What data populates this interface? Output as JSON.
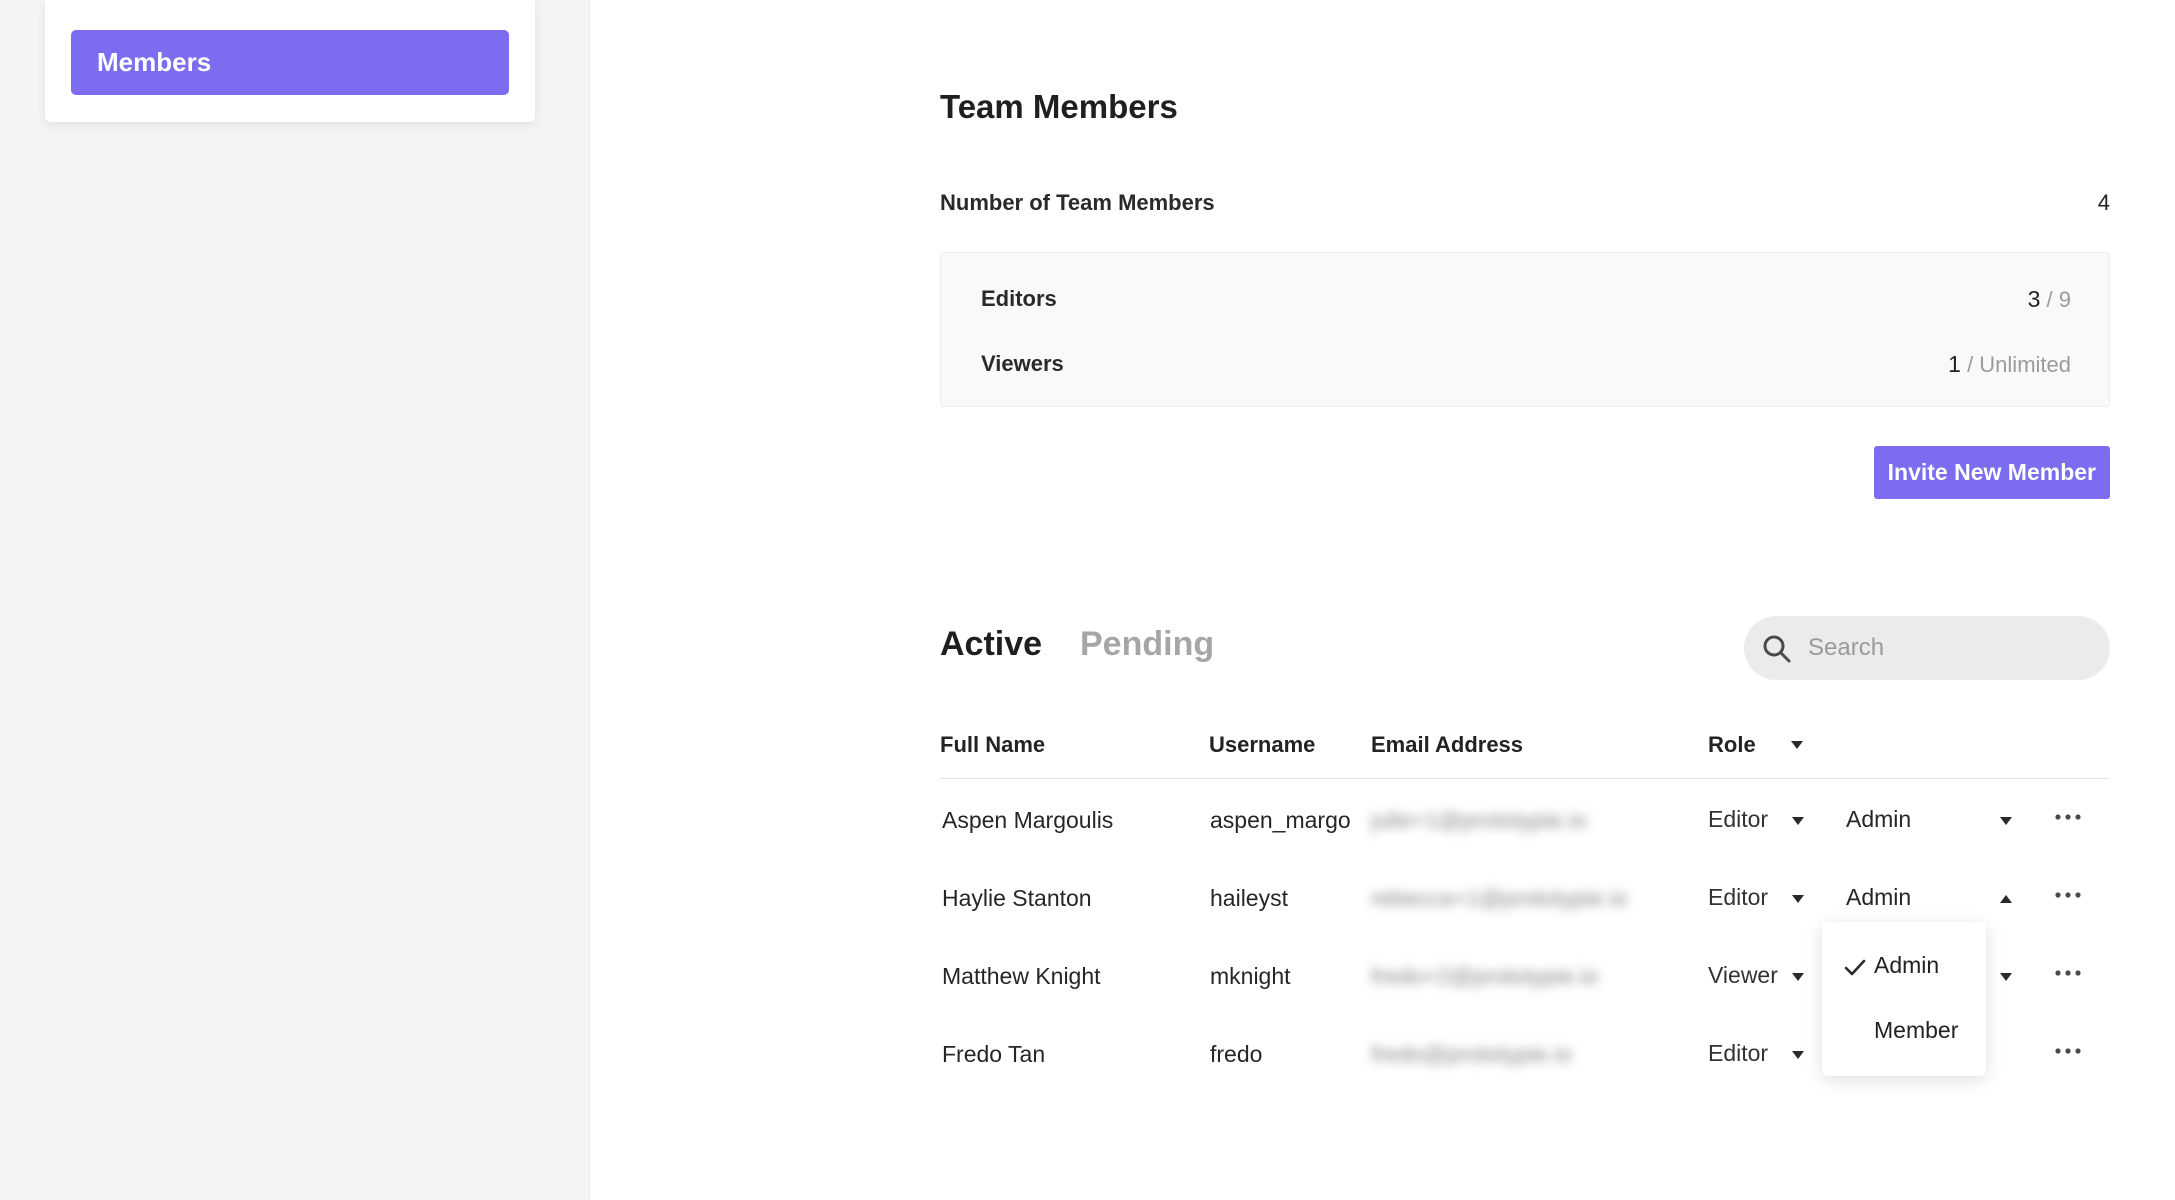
{
  "sidebar": {
    "active_item": "Members"
  },
  "page": {
    "title": "Team Members",
    "member_count_label": "Number of Team Members",
    "member_count": "4"
  },
  "quota": {
    "editors_label": "Editors",
    "editors_used": "3",
    "editors_limit": " / 9",
    "viewers_label": "Viewers",
    "viewers_used": "1",
    "viewers_limit": " / Unlimited"
  },
  "invite_button": "Invite New Member",
  "tabs": {
    "active": "Active",
    "pending": "Pending"
  },
  "search": {
    "placeholder": "Search"
  },
  "table": {
    "headers": {
      "name": "Full Name",
      "username": "Username",
      "email": "Email Address",
      "role": "Role"
    },
    "rows": [
      {
        "name": "Aspen Margoulis",
        "username": "aspen_margo",
        "email": "julie+1@prototypie.io",
        "role": "Editor",
        "admin": "Admin"
      },
      {
        "name": "Haylie Stanton",
        "username": "haileyst",
        "email": "rebecca+1@prototypie.io",
        "role": "Editor",
        "admin": "Admin"
      },
      {
        "name": "Matthew Knight",
        "username": "mknight",
        "email": "fredo+2@prototypie.io",
        "role": "Viewer",
        "admin": ""
      },
      {
        "name": "Fredo Tan",
        "username": "fredo",
        "email": "fredo@prototypie.io",
        "role": "Editor",
        "admin": ""
      }
    ]
  },
  "dropdown": {
    "options": [
      "Admin",
      "Member"
    ],
    "selected": "Admin"
  },
  "colors": {
    "accent": "#7b6cf0",
    "sidebar_bg": "#f4f4f4",
    "muted_text": "#a6a6a6"
  }
}
